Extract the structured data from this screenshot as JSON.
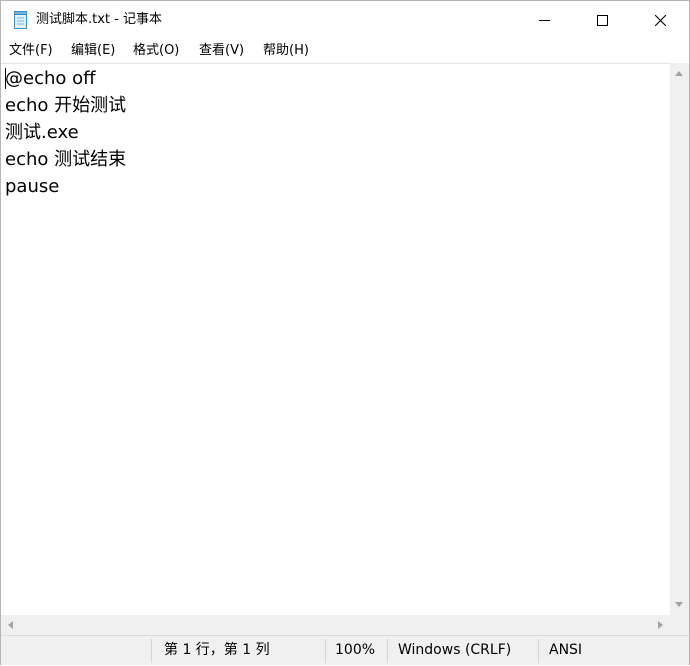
{
  "window": {
    "title": "测试脚本.txt - 记事本",
    "icon": "notepad-icon"
  },
  "controls": {
    "minimize_icon": "minimize-icon",
    "maximize_icon": "maximize-icon",
    "close_icon": "close-icon"
  },
  "menu": {
    "items": [
      {
        "label": "文件(F)"
      },
      {
        "label": "编辑(E)"
      },
      {
        "label": "格式(O)"
      },
      {
        "label": "查看(V)"
      },
      {
        "label": "帮助(H)"
      }
    ]
  },
  "editor": {
    "lines": [
      "@echo off",
      "echo 开始测试",
      "测试.exe",
      "echo 测试结束",
      "pause"
    ]
  },
  "status": {
    "position": "第 1 行，第 1 列",
    "zoom": "100%",
    "line_ending": "Windows (CRLF)",
    "encoding": "ANSI"
  }
}
